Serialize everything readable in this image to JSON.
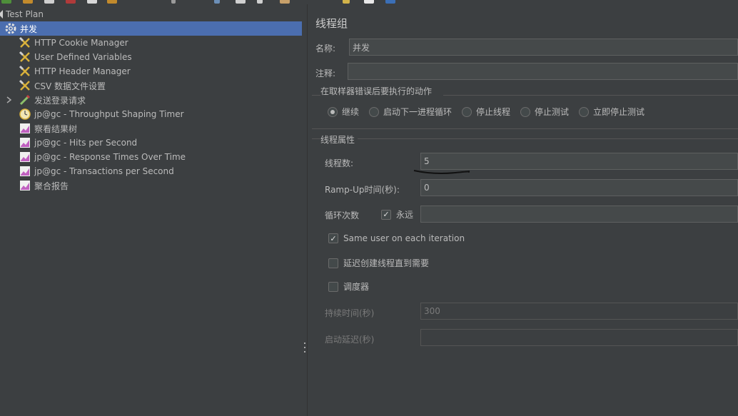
{
  "toolbar": {
    "icons": [
      "run-icon",
      "save-icon",
      "templates-icon",
      "cut-icon",
      "copy-icon",
      "paste-icon",
      "start-icon",
      "stop-icon",
      "clear-icon",
      "search-icon",
      "reset-icon",
      "function-icon",
      "help-icon"
    ]
  },
  "tree": {
    "root": "Test Plan",
    "items": [
      {
        "label": "并发",
        "icon": "thread-group-gear-icon",
        "selected": true
      },
      {
        "label": "HTTP Cookie Manager",
        "icon": "config-wrench-icon"
      },
      {
        "label": "User Defined Variables",
        "icon": "config-wrench-icon"
      },
      {
        "label": "HTTP Header Manager",
        "icon": "config-wrench-icon"
      },
      {
        "label": "CSV 数据文件设置",
        "icon": "config-wrench-icon"
      },
      {
        "label": "发送登录请求",
        "icon": "sampler-pipette-icon",
        "expandable": true
      },
      {
        "label": "jp@gc - Throughput Shaping Timer",
        "icon": "timer-clock-icon"
      },
      {
        "label": "察看结果树",
        "icon": "listener-chart-icon"
      },
      {
        "label": "jp@gc - Hits per Second",
        "icon": "listener-chart-icon"
      },
      {
        "label": "jp@gc - Response Times Over Time",
        "icon": "listener-chart-icon"
      },
      {
        "label": "jp@gc - Transactions per Second",
        "icon": "listener-chart-icon"
      },
      {
        "label": "聚合报告",
        "icon": "listener-chart-icon"
      }
    ]
  },
  "panel": {
    "title": "线程组",
    "name_label": "名称:",
    "name_value": "并发",
    "comment_label": "注释:",
    "comment_value": "",
    "error_group_title": "在取样器错误后要执行的动作",
    "error_actions": [
      {
        "label": "继续",
        "selected": true
      },
      {
        "label": "启动下一进程循环",
        "selected": false
      },
      {
        "label": "停止线程",
        "selected": false
      },
      {
        "label": "停止测试",
        "selected": false
      },
      {
        "label": "立即停止测试",
        "selected": false
      }
    ],
    "props_title": "线程属性",
    "threads_label": "线程数:",
    "threads_value": "5",
    "rampup_label": "Ramp-Up时间(秒):",
    "rampup_value": "0",
    "loop_label": "循环次数",
    "loop_forever_label": "永远",
    "loop_forever_checked": true,
    "loop_value": "",
    "same_user_label": "Same user on each iteration",
    "same_user_checked": true,
    "delay_label": "延迟创建线程直到需要",
    "delay_checked": false,
    "scheduler_label": "调度器",
    "scheduler_checked": false,
    "duration_label": "持续时间(秒)",
    "duration_value": "300",
    "startup_delay_label": "启动延迟(秒)",
    "startup_delay_value": ""
  }
}
